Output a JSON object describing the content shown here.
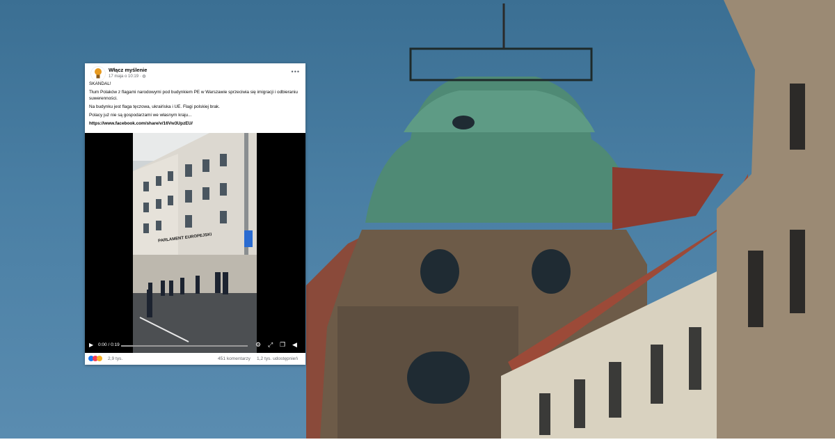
{
  "post": {
    "page_name": "Włącz myślenie",
    "timestamp": "17 maja o 10:19 · ",
    "more_icon": "more-horizontal-icon",
    "paragraphs": [
      "SKANDAL!",
      "Tłum Polaków z flagami narodowymi pod budynkiem PE w Warszawie sprzeciwia się imigracji i odbieraniu suwerenności.",
      "Na budynku jest flaga tęczowa, ukraińska i UE. Flagi polskiej brak.",
      "Polacy już nie są gospodarzami we własnym kraju..."
    ],
    "link": "https://www.facebook.com/share/v/16Vw3UpzEU/",
    "video": {
      "building_sign": "PARLAMENT EUROPEJSKI",
      "time": "0:00 / 0:19",
      "progress": 0
    },
    "reactions": {
      "count": "2,9 tys.",
      "comments": "451 komentarzy",
      "shares": "1,2 tys. udostępnień"
    }
  }
}
